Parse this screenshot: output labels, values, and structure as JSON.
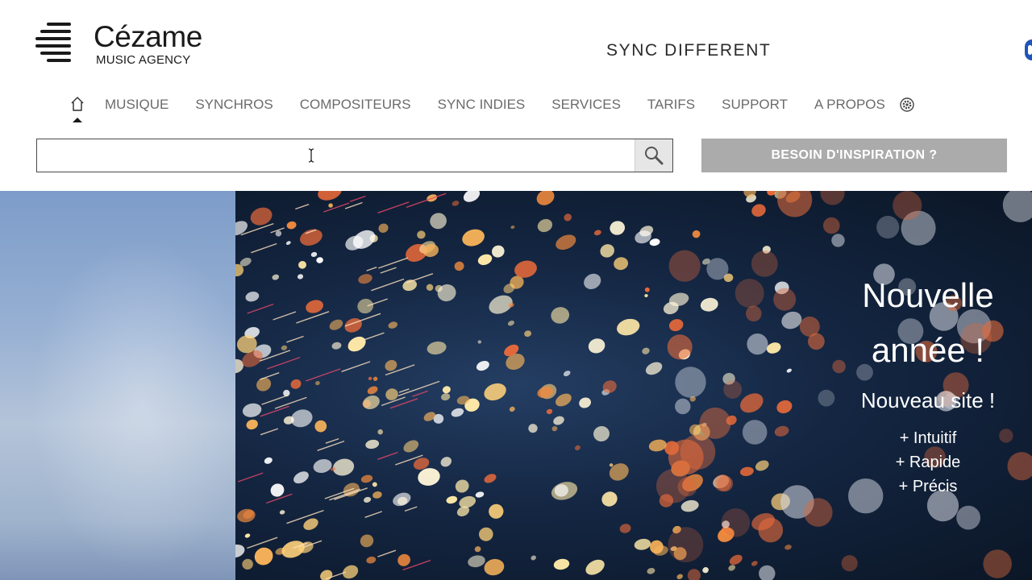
{
  "brand": {
    "name": "Cézame",
    "subtitle": "MUSIC AGENCY",
    "tagline": "SYNC DIFFERENT"
  },
  "nav": {
    "items": [
      {
        "label": "MUSIQUE"
      },
      {
        "label": "SYNCHROS"
      },
      {
        "label": "COMPOSITEURS"
      },
      {
        "label": "SYNC INDIES"
      },
      {
        "label": "SERVICES"
      },
      {
        "label": "TARIFS"
      },
      {
        "label": "SUPPORT"
      },
      {
        "label": "A PROPOS"
      }
    ],
    "icons": [
      "home-icon",
      "settings-icon"
    ]
  },
  "search": {
    "value": "",
    "placeholder": "",
    "icon": "search-icon"
  },
  "inspiration_button": {
    "label": "BESOIN D'INSPIRATION ?"
  },
  "hero": {
    "title_line1": "Nouvelle",
    "title_line2": "année !",
    "subtitle": "Nouveau site !",
    "points": [
      "+ Intuitif",
      "+ Rapide",
      "+ Précis"
    ]
  },
  "colors": {
    "text_dark": "#1a1a1a",
    "nav_text": "#6b6b6b",
    "button_gray": "#ababab",
    "hero_bg": "#142642",
    "accent_blue": "#1f55b8"
  }
}
